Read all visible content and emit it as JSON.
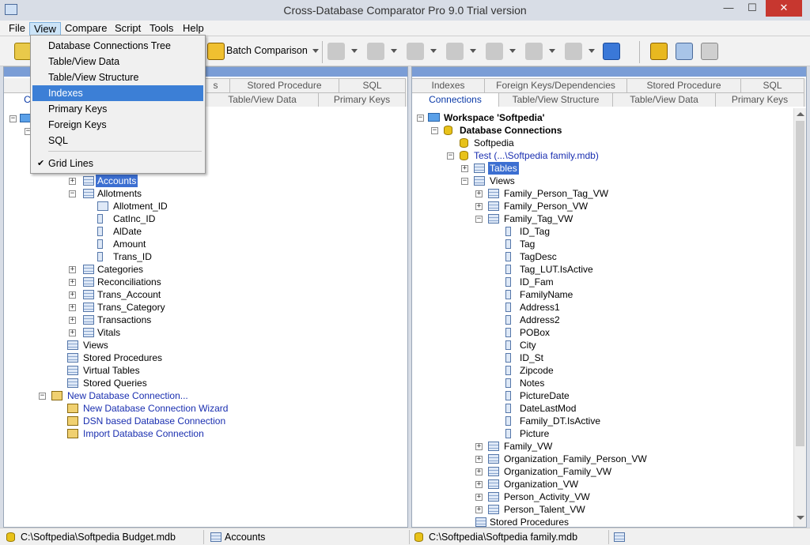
{
  "window": {
    "title": "Cross-Database Comparator Pro 9.0 Trial version",
    "minimize": "—",
    "maximize": "☐",
    "close": "✕"
  },
  "menu": [
    "File",
    "View",
    "Compare",
    "Script",
    "Tools",
    "Help"
  ],
  "toolbar": {
    "batch_label": "Batch Comparison"
  },
  "view_menu": {
    "items": [
      "Database Connections Tree",
      "Table/View Data",
      "Table/View Structure",
      "Indexes",
      "Primary Keys",
      "Foreign Keys",
      "SQL"
    ],
    "highlighted": "Indexes",
    "grid_lines": "Grid   Lines",
    "grid_check": "✔"
  },
  "left": {
    "tabs_top": [
      "s",
      "Stored Procedure",
      "SQL"
    ],
    "tabs_bottom": [
      "C",
      "Table/View Data",
      "Primary Keys"
    ],
    "tree": [
      {
        "label": "Accounts"
      },
      {
        "label": "Allotments"
      },
      {
        "label": "Allotment_ID"
      },
      {
        "label": "CatInc_ID"
      },
      {
        "label": "AlDate"
      },
      {
        "label": "Amount"
      },
      {
        "label": "Trans_ID"
      },
      {
        "label": "Categories"
      },
      {
        "label": "Reconciliations"
      },
      {
        "label": "Trans_Account"
      },
      {
        "label": "Trans_Category"
      },
      {
        "label": "Transactions"
      },
      {
        "label": "Vitals"
      },
      {
        "label": "Views"
      },
      {
        "label": "Stored Procedures"
      },
      {
        "label": "Virtual Tables"
      },
      {
        "label": "Stored Queries"
      },
      {
        "label": "New Database Connection..."
      },
      {
        "label": "New Database Connection Wizard"
      },
      {
        "label": "DSN based Database Connection"
      },
      {
        "label": "Import Database Connection"
      }
    ]
  },
  "right": {
    "tabs_top": [
      "Indexes",
      "Foreign Keys/Dependencies",
      "Stored Procedure",
      "SQL"
    ],
    "tabs_bottom": [
      "Connections",
      "Table/View Structure",
      "Table/View Data",
      "Primary Keys"
    ],
    "tree": [
      {
        "label": "Workspace 'Softpedia'"
      },
      {
        "label": "Database Connections"
      },
      {
        "label": "Softpedia"
      },
      {
        "label": "Test  (...\\Softpedia family.mdb)"
      },
      {
        "label": "Tables"
      },
      {
        "label": "Views"
      },
      {
        "label": "Family_Person_Tag_VW"
      },
      {
        "label": "Family_Person_VW"
      },
      {
        "label": "Family_Tag_VW"
      },
      {
        "label": "ID_Tag"
      },
      {
        "label": "Tag"
      },
      {
        "label": "TagDesc"
      },
      {
        "label": "Tag_LUT.IsActive"
      },
      {
        "label": "ID_Fam"
      },
      {
        "label": "FamilyName"
      },
      {
        "label": "Address1"
      },
      {
        "label": "Address2"
      },
      {
        "label": "POBox"
      },
      {
        "label": "City"
      },
      {
        "label": "ID_St"
      },
      {
        "label": "Zipcode"
      },
      {
        "label": "Notes"
      },
      {
        "label": "PictureDate"
      },
      {
        "label": "DateLastMod"
      },
      {
        "label": "Family_DT.IsActive"
      },
      {
        "label": "Picture"
      },
      {
        "label": "Family_VW"
      },
      {
        "label": "Organization_Family_Person_VW"
      },
      {
        "label": "Organization_Family_VW"
      },
      {
        "label": "Organization_VW"
      },
      {
        "label": "Person_Activity_VW"
      },
      {
        "label": "Person_Talent_VW"
      },
      {
        "label": "Stored Procedures"
      }
    ]
  },
  "status": {
    "left_path": "C:\\Softpedia\\Softpedia Budget.mdb",
    "left_table": "Accounts",
    "right_path": "C:\\Softpedia\\Softpedia family.mdb"
  },
  "expand_plus": "+",
  "expand_minus": "−"
}
